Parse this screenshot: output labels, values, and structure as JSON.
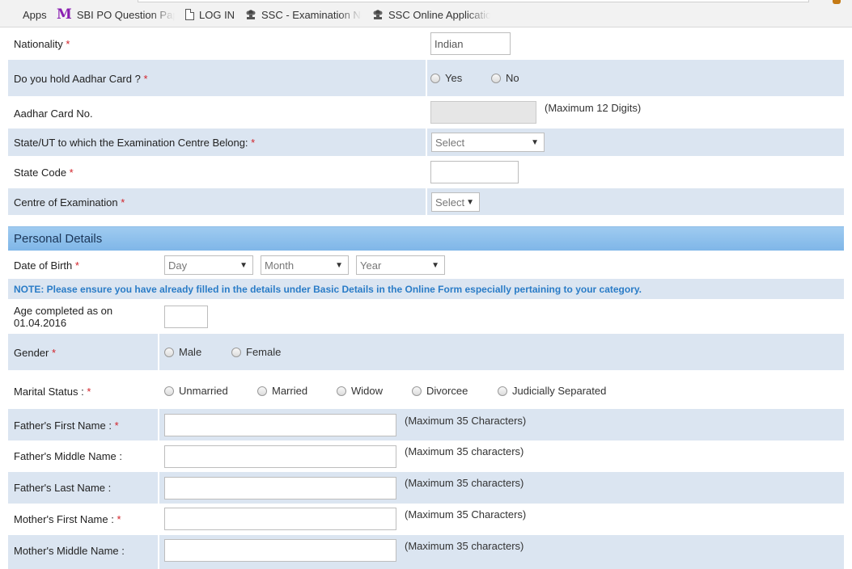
{
  "bookmarks": [
    {
      "icon": "apps-grid-icon",
      "label": "Apps"
    },
    {
      "icon": "gmail-m-icon",
      "label": "SBI PO Question Pape"
    },
    {
      "icon": "document-icon",
      "label": "LOG IN"
    },
    {
      "icon": "emblem-icon",
      "label": "SSC - Examination No"
    },
    {
      "icon": "emblem-icon",
      "label": "SSC Online Applicatio"
    }
  ],
  "form": {
    "required_mark": "*",
    "nationality": {
      "label": "Nationality",
      "value": "Indian"
    },
    "aadhar_hold": {
      "label": "Do you hold Aadhar Card ?",
      "options": [
        "Yes",
        "No"
      ]
    },
    "aadhar_no": {
      "label": "Aadhar Card No.",
      "hint": "(Maximum 12 Digits)"
    },
    "state_ut": {
      "label": "State/UT to which the Examination Centre Belong:",
      "selected": "Select"
    },
    "state_code": {
      "label": "State Code"
    },
    "centre": {
      "label": "Centre of Examination",
      "selected": "Select"
    }
  },
  "personal": {
    "section_title": "Personal Details",
    "dob": {
      "label": "Date of Birth",
      "day": "Day",
      "month": "Month",
      "year": "Year"
    },
    "note": "NOTE: Please ensure you have already filled in the details under Basic Details in the Online Form especially pertaining to your category.",
    "age": {
      "label_line1": "Age completed as on",
      "label_line2": "01.04.2016"
    },
    "gender": {
      "label": "Gender",
      "options": [
        "Male",
        "Female"
      ]
    },
    "marital": {
      "label": "Marital Status :",
      "options": [
        "Unmarried",
        "Married",
        "Widow",
        "Divorcee",
        "Judicially Separated"
      ]
    },
    "father_first": {
      "label": "Father's First Name :",
      "hint": "(Maximum 35 Characters)"
    },
    "father_middle": {
      "label": "Father's Middle Name :",
      "hint": "(Maximum 35 characters)"
    },
    "father_last": {
      "label": "Father's Last Name :",
      "hint": "(Maximum 35 characters)"
    },
    "mother_first": {
      "label": "Mother's First Name :",
      "hint": "(Maximum 35 Characters)"
    },
    "mother_middle": {
      "label": "Mother's Middle Name :",
      "hint": "(Maximum 35 characters)"
    }
  },
  "colors": {
    "row_alt": "#dbe5f1",
    "header": "#8fc2ee",
    "required": "#d2232a",
    "note": "#2a7cc7"
  }
}
